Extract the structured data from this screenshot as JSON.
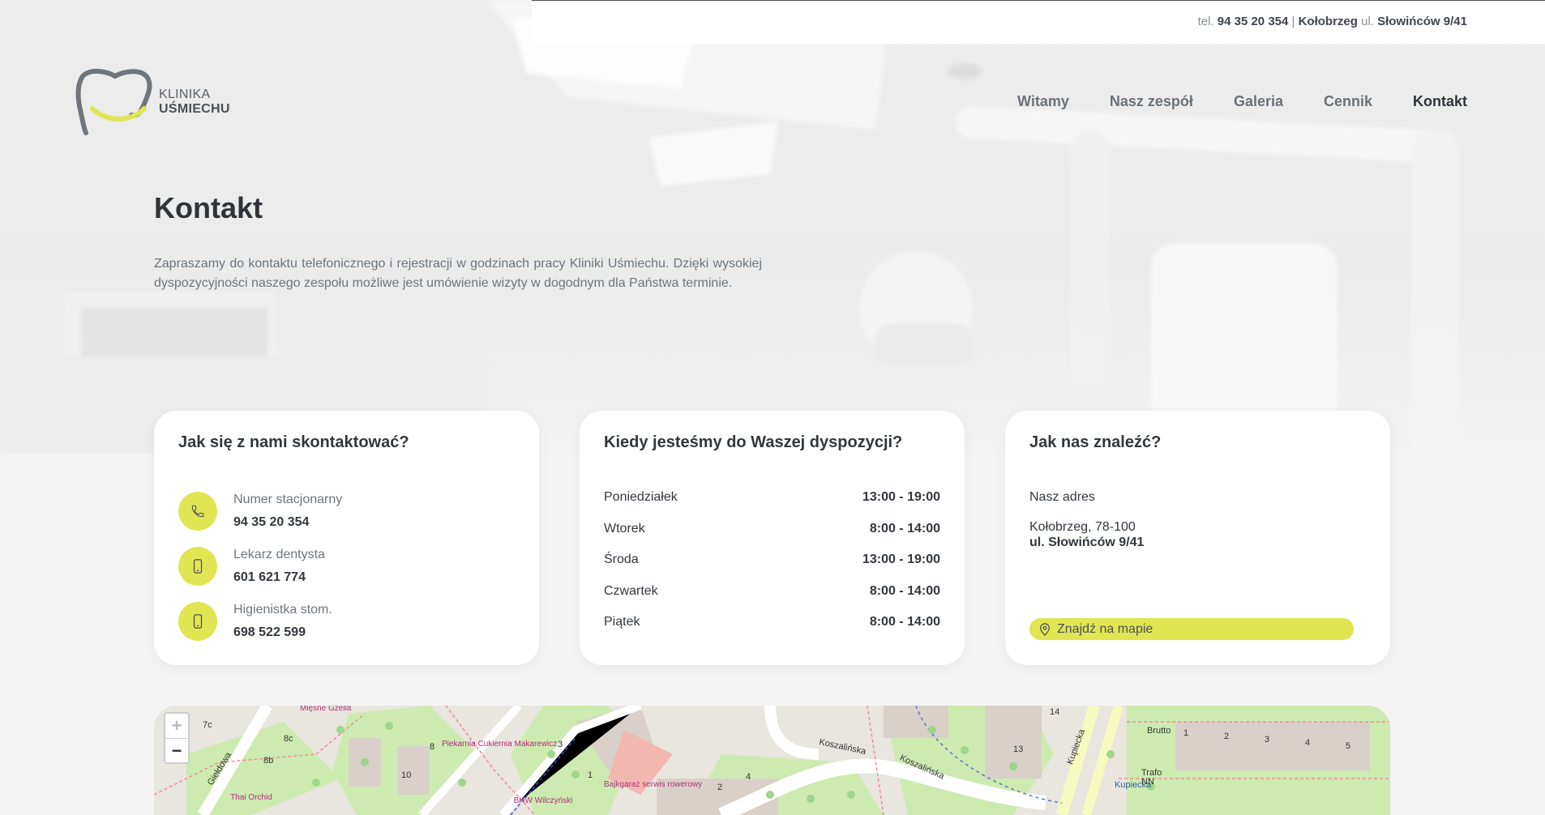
{
  "topbar": {
    "tel_prefix": "tel. ",
    "phone": "94 35 20 354",
    "separator": " | ",
    "city": "Kołobrzeg",
    "street_prefix": " ul. ",
    "street": "Słowińców 9/41"
  },
  "logo": {
    "line1": "KLINIKA",
    "line2": "UŚMIECHU"
  },
  "nav": [
    "Witamy",
    "Nasz zespół",
    "Galeria",
    "Cennik",
    "Kontakt"
  ],
  "nav_active": "Kontakt",
  "page": {
    "title": "Kontakt",
    "intro": "Zapraszamy do kontaktu telefonicznego i rejestracji w godzinach pracy Kliniki Uśmiechu. Dzięki wysokiej dyspozycyjności naszego zespołu możliwe jest umówienie wizyty w dogodnym dla Państwa terminie."
  },
  "contact_card": {
    "title": "Jak się z nami skontaktować?",
    "items": [
      {
        "label": "Numer stacjonarny",
        "number": "94 35 20 354",
        "icon": "phone-icon"
      },
      {
        "label": "Lekarz dentysta",
        "number": "601 621 774",
        "icon": "mobile-icon"
      },
      {
        "label": "Higienistka stom.",
        "number": "698 522 599",
        "icon": "mobile-icon"
      }
    ]
  },
  "hours_card": {
    "title": "Kiedy jesteśmy do Waszej dyspozycji?",
    "rows": [
      {
        "day": "Poniedziałek",
        "time": "13:00 - 19:00"
      },
      {
        "day": "Wtorek",
        "time": "8:00 - 14:00"
      },
      {
        "day": "Środa",
        "time": "13:00 - 19:00"
      },
      {
        "day": "Czwartek",
        "time": "8:00 - 14:00"
      },
      {
        "day": "Piątek",
        "time": "8:00 - 14:00"
      }
    ]
  },
  "address_card": {
    "title": "Jak nas znaleźć?",
    "label": "Nasz adres",
    "city": "Kołobrzeg, 78-100",
    "street": "ul. Słowińców 9/41",
    "button": "Znajdź na mapie"
  },
  "map": {
    "zoom_in": "+",
    "zoom_out": "−",
    "labels": {
      "koszalinska1": "Koszalińska",
      "koszalinska2": "Koszalińska",
      "giełdowa": "Giełdowa",
      "kupiecka1": "Kupiecka",
      "kupiecka2": "Kupiecka",
      "brutto": "Brutto",
      "trafo": "Trafo NN",
      "n10": "10",
      "n8": "8",
      "n8b": "8b",
      "n8c": "8c",
      "n7c": "7c",
      "n3": "3",
      "n1": "1",
      "n4": "4",
      "n13": "13",
      "n14": "14",
      "n2": "2",
      "b1": "1",
      "b2": "2",
      "b3": "3",
      "b4": "4",
      "b5": "5"
    },
    "pois": {
      "miesne": "Mięsne Gzella",
      "piekarnia": "Piekarnia Cukiernia Makarewicz",
      "thai": "Thai Orchid",
      "bhw": "BHW Wilczyński",
      "bajkgaraz": "Bajkgaraż serwis rowerowy"
    }
  },
  "colors": {
    "accent": "#dfe652",
    "text_dark": "#33373c",
    "text_muted": "#6f757d"
  }
}
